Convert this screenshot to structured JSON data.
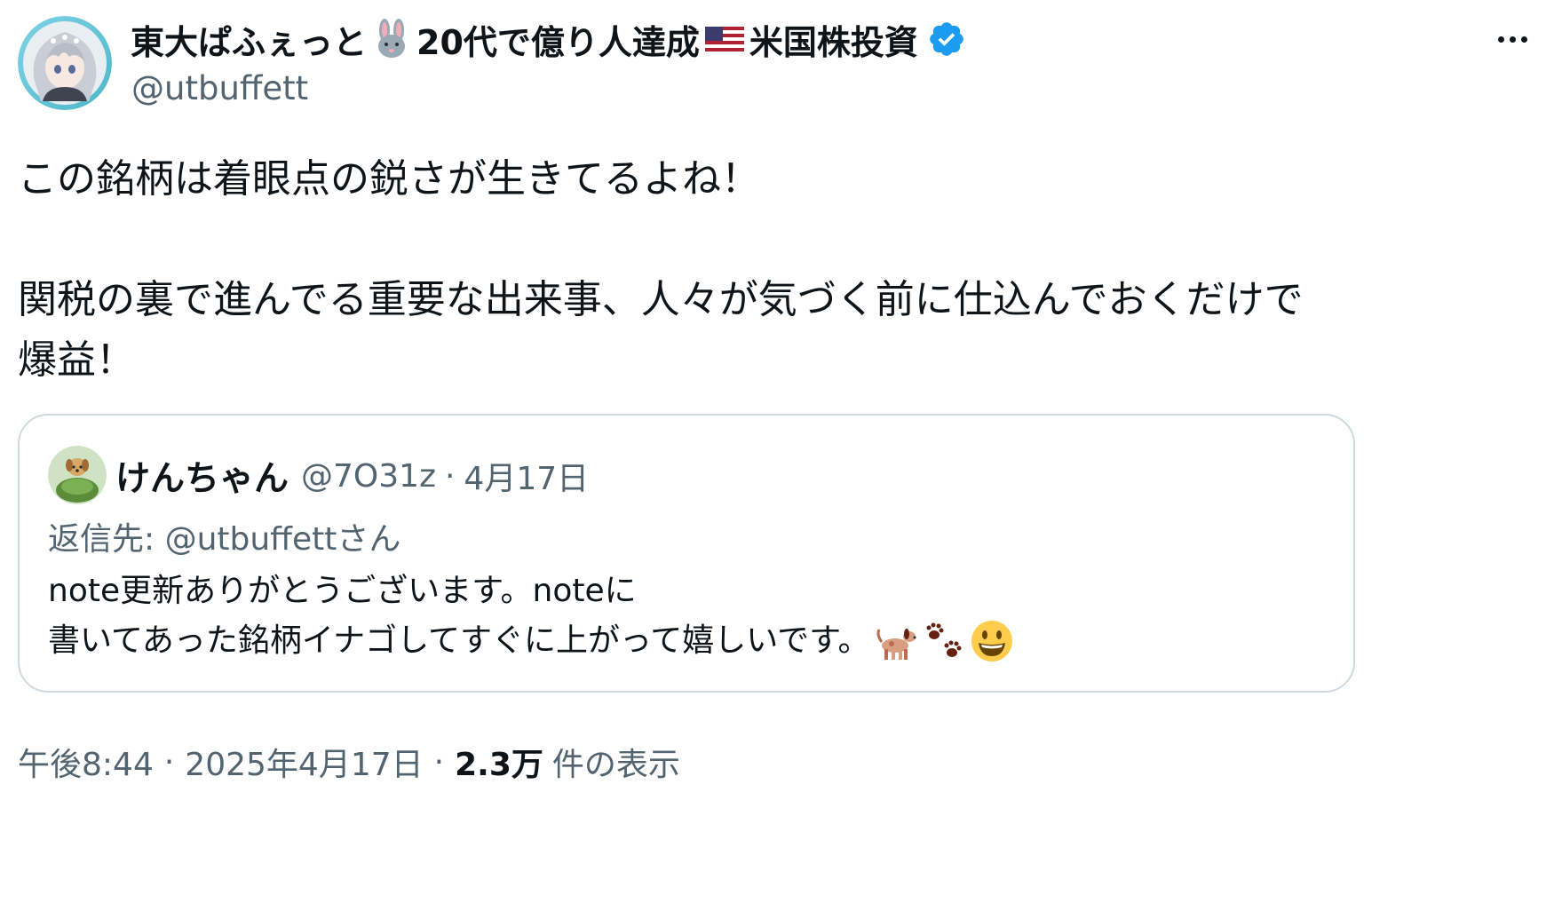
{
  "author": {
    "name_part1": "東大ぱふぇっと",
    "name_part2": "20代で億り人達成",
    "name_part3": "米国株投資",
    "handle": "@utbuffett"
  },
  "icons": {
    "name_emoji_1": "rabbit-face-icon",
    "name_emoji_2": "us-flag-icon",
    "verified": "verified-badge-icon",
    "more": "more-options-icon"
  },
  "tweet": {
    "line1": "この銘柄は着眼点の鋭さが生きてるよね！",
    "line2": "関税の裏で進んでる重要な出来事、人々が気づく前に仕込んでおくだけで",
    "line3": "爆益！"
  },
  "quote": {
    "name": "けんちゃん",
    "handle": "@7O31z",
    "separator": "·",
    "date": "4月17日",
    "reply_to": "返信先: @utbuffettさん",
    "text_line1": "note更新ありがとうございます。noteに",
    "text_line2": "書いてあった銘柄イナゴしてすぐに上がって嬉しいです。",
    "emojis": [
      "dog-icon",
      "paw-prints-icon",
      "grinning-face-icon"
    ]
  },
  "footer": {
    "time": "午後8:44",
    "separator": "·",
    "date": "2025年4月17日",
    "views_count": "2.3万",
    "views_label": "件の表示"
  },
  "colors": {
    "text_primary": "#0f1419",
    "text_secondary": "#536471",
    "border": "#cfd9de",
    "verified_blue": "#1d9bf0"
  }
}
